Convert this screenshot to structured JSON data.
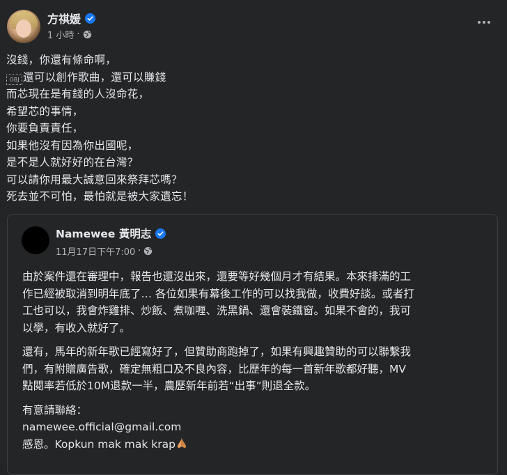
{
  "post": {
    "author": "方祺媛",
    "time": "1 小時",
    "separator": "·",
    "lines_before": [
      "沒錢，你還有條命啊，"
    ],
    "line2_glyph": "OBJ",
    "line2_text": "還可以創作歌曲，還可以賺錢",
    "lines_after": [
      "而芯現在是有錢的人沒命花，",
      "希望芯的事情，",
      "你要負責責任，",
      "如果他沒有因為你出國呢，",
      "是不是人就好好的在台灣？",
      "可以請你用最大誠意回來祭拜芯嗎？",
      "死去並不可怕，最怕就是被大家遺忘！"
    ]
  },
  "shared": {
    "author": "Namewee 黃明志",
    "time": "11月17日下午7:00",
    "separator": "·",
    "paragraph1": [
      "由於案件還在審理中，報告也還沒出來，還要等好幾個月才有結果。本來排滿的工",
      "作已經被取消到明年底了… 各位如果有幕後工作的可以找我做，收費好談。或者打",
      "工也可以，我會炸雞排、炒飯、煮咖喱、洗黑鍋、還會裝鐵窗。如果不會的，我可",
      "以學，有收入就好了。"
    ],
    "paragraph2": [
      "還有，馬年的新年歌已經寫好了，但贊助商跑掉了，如果有興趣贊助的可以聯繫我",
      "們，有附贈廣告歌，確定無粗口及不良內容，比歷年的每一首新年歌都好聽，MV",
      "點閱率若低於10M退款一半，農歷新年前若“出事”則退全款。"
    ],
    "contact_label": "有意請聯絡：",
    "email": "namewee.official@gmail.com",
    "thanks": "感恩。Kopkun mak mak krap"
  },
  "icons": {
    "verified": "verified-badge-icon",
    "globe": "globe-icon",
    "more": "more-options-icon",
    "pray": "folded-hands-emoji"
  },
  "colors": {
    "background": "#242526",
    "text": "#e4e6eb",
    "secondary": "#b0b3b8",
    "verified": "#1877f2",
    "border": "#3e4042"
  }
}
